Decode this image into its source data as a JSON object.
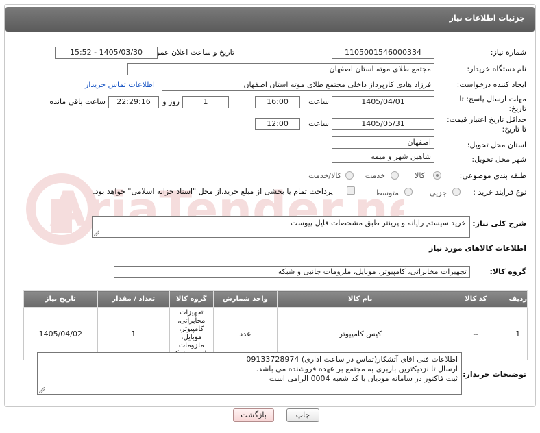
{
  "header": {
    "title": "جزئیات اطلاعات نیاز"
  },
  "fields": {
    "need_number_label": "شماره نیاز:",
    "need_number": "1105001546000334",
    "announce_label": "تاریخ و ساعت اعلان عمومی:",
    "announce_value": "1405/03/30 - 15:52",
    "buyer_org_label": "نام دستگاه خریدار:",
    "buyer_org": "مجتمع طلای موته استان اصفهان",
    "creator_label": "ایجاد کننده درخواست:",
    "creator": "فرزاد هادی کارپرداز داخلی مجتمع طلای موته استان اصفهان",
    "contact_link": "اطلاعات تماس خریدار",
    "deadline_label_1": "مهلت ارسال پاسخ: تا",
    "deadline_label_2": "تاریخ:",
    "deadline_date": "1405/04/01",
    "time_label": "ساعت",
    "deadline_time": "16:00",
    "days_value": "1",
    "days_label": "روز و",
    "remaining_time": "22:29:16",
    "remaining_label": "ساعت باقی مانده",
    "price_label_1": "حداقل تاریخ اعتبار قیمت:",
    "price_label_2": "تا تاریخ:",
    "price_date": "1405/05/31",
    "price_time": "12:00",
    "province_label": "استان محل تحویل:",
    "province": "اصفهان",
    "city_label": "شهر محل تحویل:",
    "city": "شاهین شهر و میمه",
    "category_label": "طبقه بندی موضوعی:",
    "category_options": [
      "کالا",
      "خدمت",
      "کالا/خدمت"
    ],
    "process_label": "نوع فرآیند خرید :",
    "process_options": [
      "جزیی",
      "متوسط"
    ],
    "payment_note": "پرداخت تمام یا بخشی از مبلغ خرید،از محل \"اسناد خزانه اسلامی\" خواهد بود.",
    "summary_label": "شرح کلی نیاز:",
    "summary": "خرید سیستم رایانه و پرینتر طبق مشخصات فایل پیوست",
    "goods_info_title": "اطلاعات کالاهای مورد نیاز",
    "goods_group_label": "گروه کالا:",
    "goods_group": "تجهیزات مخابراتی، کامپیوتر، موبایل، ملزومات جانبی و شبکه"
  },
  "table": {
    "headers": [
      "ردیف",
      "کد کالا",
      "نام کالا",
      "واحد شمارش",
      "گروه کالا",
      "تعداد / مقدار",
      "تاریخ نیاز"
    ],
    "rows": [
      [
        "1",
        "--",
        "کیس کامپیوتر",
        "عدد",
        "تجهیزات مخابراتی، کامپیوتر، موبایل، ملزومات جانبی و شبکه",
        "1",
        "1405/04/02"
      ]
    ]
  },
  "buyer_notes": {
    "label": "توضیحات خریدار:",
    "lines": [
      "اطلاعات فنی اقای آتشکار(تماس در ساعت اداری) 09133728974",
      "ارسال تا نزدیکترین باربری به مجتمع بر عهده فروشنده می باشد.",
      "ثبت فاکتور در سامانه مودیان با کد شعبه 0004 الزامی است"
    ]
  },
  "buttons": {
    "print": "چاپ",
    "back": "بازگشت"
  },
  "watermark": "AriaTender.net"
}
